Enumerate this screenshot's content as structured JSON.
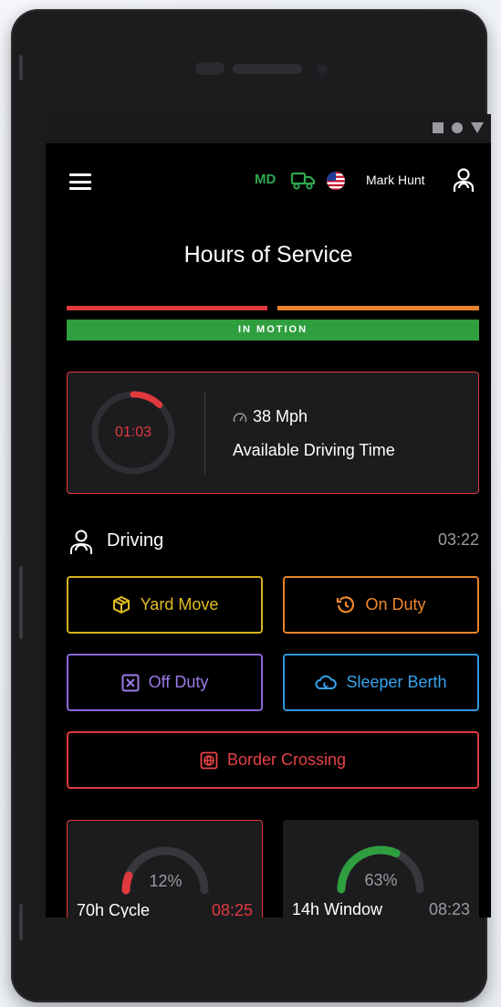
{
  "header": {
    "state_code": "MD",
    "user_name": "Mark Hunt"
  },
  "page": {
    "title": "Hours of Service",
    "status_banner": "IN MOTION"
  },
  "timer_card": {
    "remaining": "01:03",
    "remaining_fraction": 0.12,
    "speed": "38 Mph",
    "available_label": "Available Driving Time"
  },
  "current_status": {
    "label": "Driving",
    "elapsed": "03:22"
  },
  "actions": {
    "yard_move": "Yard Move",
    "on_duty": "On Duty",
    "off_duty": "Off Duty",
    "sleeper_berth": "Sleeper Berth",
    "border_crossing": "Border Crossing"
  },
  "stats": {
    "cycle": {
      "label": "70h Cycle",
      "percent_text": "12%",
      "percent": 12,
      "time": "08:25"
    },
    "window": {
      "label": "14h Window",
      "percent_text": "63%",
      "percent": 63,
      "time": "08:23"
    }
  },
  "colors": {
    "red": "#e0393e",
    "orange": "#e9832b",
    "green": "#2f9e3f",
    "yellow": "#d4b11d",
    "purple": "#8a68d8",
    "blue": "#2e97dc"
  },
  "icons": {
    "menu": "hamburger-menu-icon",
    "truck": "truck-icon",
    "flag": "us-flag-icon",
    "user": "user-icon",
    "speed": "speedometer-icon",
    "driver": "person-icon",
    "yard": "package-icon",
    "on_duty": "clock-rotate-icon",
    "off_duty": "x-box-icon",
    "sleeper": "cloud-moon-icon",
    "border": "globe-icon"
  }
}
